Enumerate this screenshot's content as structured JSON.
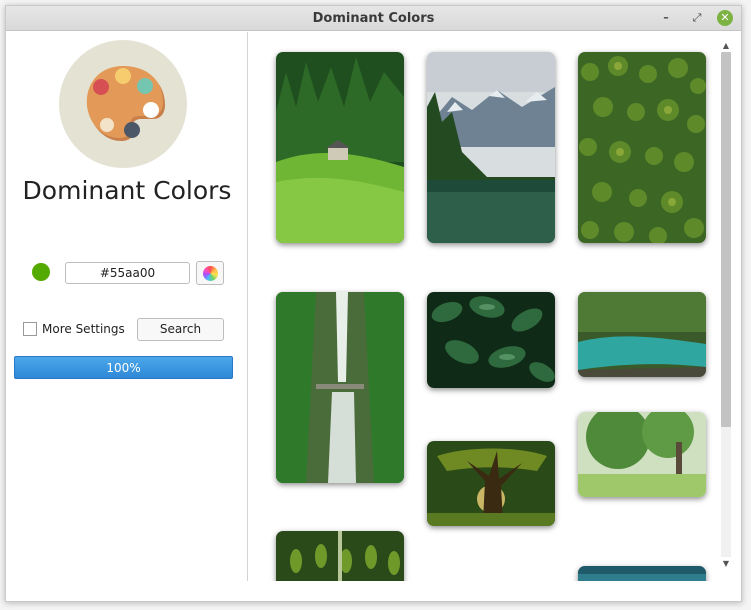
{
  "window": {
    "title": "Dominant Colors",
    "controls": {
      "minimize": "–",
      "maximize": "⤢",
      "close": "✕"
    }
  },
  "sidebar": {
    "app_title": "Dominant Colors",
    "color_swatch": "#55aa00",
    "hex_value": "#55aa00",
    "more_settings_label": "More Settings",
    "more_settings_checked": false,
    "search_label": "Search",
    "progress_percent": 100,
    "progress_label": "100%"
  },
  "gallery": {
    "images": [
      {
        "name": "forest-meadow-cabin",
        "palette": [
          "#1f4e1f",
          "#3f8a2a",
          "#7ac23a"
        ]
      },
      {
        "name": "mountain-lake-pines",
        "palette": [
          "#bfc9d1",
          "#5a6d7c",
          "#1d3a2a"
        ]
      },
      {
        "name": "pine-forest-aerial",
        "palette": [
          "#2f5a1e",
          "#6b8f2a",
          "#3d6a22"
        ]
      },
      {
        "name": "waterfall-gorge",
        "palette": [
          "#1e5a22",
          "#3f8f30",
          "#dfe8e0"
        ]
      },
      {
        "name": "dark-green-leaves",
        "palette": [
          "#0f2a16",
          "#2e6a3e",
          "#6fae7c"
        ]
      },
      {
        "name": "turquoise-river",
        "palette": [
          "#2a4a22",
          "#1f8a85",
          "#6a8a40"
        ]
      },
      {
        "name": "ancient-tree-sunlight",
        "palette": [
          "#1e3a12",
          "#6f8a22",
          "#f2d27a"
        ]
      },
      {
        "name": "sunny-tree-orchard",
        "palette": [
          "#4f8a3a",
          "#9ec86a",
          "#e6efe0"
        ]
      },
      {
        "name": "green-succulents",
        "palette": [
          "#1e3a1a",
          "#4f7a2a",
          "#8fb24a"
        ]
      },
      {
        "name": "teal-water-partial",
        "palette": [
          "#1e5a6a",
          "#3a8a9a",
          "#0f3a4a"
        ]
      }
    ]
  },
  "scrollbar": {
    "up": "▲",
    "down": "▼"
  }
}
